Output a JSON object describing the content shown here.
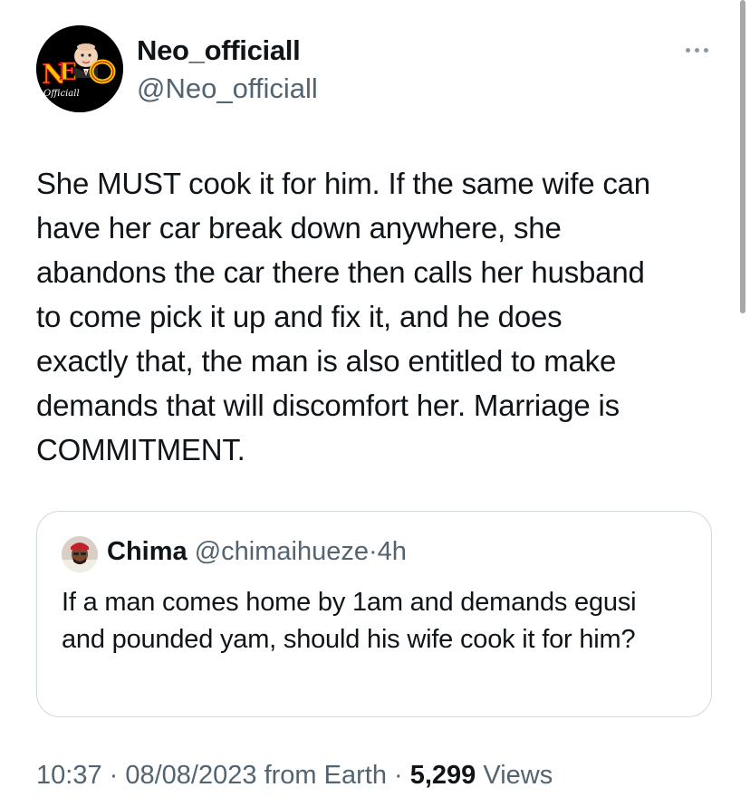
{
  "author": {
    "name": "Neo_officiall",
    "handle": "@Neo_officiall",
    "avatar_logo_text": "NEO",
    "avatar_sub_text": "Officiall"
  },
  "more_icon": "more-horizontal-icon",
  "tweet": {
    "text": "She MUST cook it for him. If the same wife can\nhave her car break down anywhere, she\nabandons the car there then calls her husband\nto come pick it up and fix it, and he does\nexactly that, the man is also entitled to make\ndemands that will discomfort her. Marriage is\nCOMMITMENT."
  },
  "quote": {
    "name": "Chima",
    "handle": "@chimaihueze",
    "separator": "·",
    "time": "4h",
    "text": "If a man comes home by 1am and demands egusi and pounded yam, should his wife cook it for him?"
  },
  "meta": {
    "time": "10:37",
    "sep1": " · ",
    "date": "08/08/2023",
    "source": " from Earth",
    "sep2": " · ",
    "views_count": "5,299",
    "views_label": " Views"
  },
  "colors": {
    "text": "#0f1419",
    "secondary": "#536471",
    "border": "#cfd9de",
    "logo_yellow": "#f5c400"
  }
}
